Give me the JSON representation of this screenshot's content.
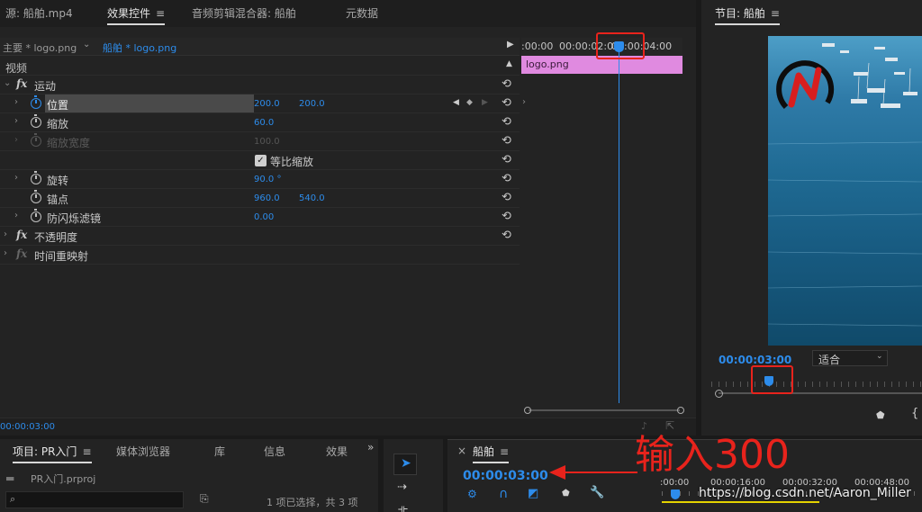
{
  "top_tabs": {
    "source": "源: 船舶.mp4",
    "effect_controls": "效果控件",
    "audio_mixer": "音频剪辑混合器: 船舶",
    "metadata": "元数据"
  },
  "program": {
    "title": "节目: 船舶",
    "timecode": "00:00:03:00",
    "fit": "适合"
  },
  "effect_panel": {
    "master_clip": "主要 * logo.png",
    "seq_clip": "船舶 * logo.png",
    "section_video": "视频",
    "timeline_times": [
      ":00:00",
      "00:00:02:00",
      "00:00:04:00"
    ],
    "clip_name": "logo.png",
    "rows": [
      {
        "label": "运动"
      },
      {
        "label": "位置",
        "v1": "200.0",
        "v2": "200.0"
      },
      {
        "label": "缩放",
        "v1": "60.0"
      },
      {
        "label": "缩放宽度",
        "v1": "100.0"
      },
      {
        "label": "等比缩放"
      },
      {
        "label": "旋转",
        "v1": "90.0 °"
      },
      {
        "label": "锚点",
        "v1": "960.0",
        "v2": "540.0"
      },
      {
        "label": "防闪烁滤镜",
        "v1": "0.00"
      },
      {
        "label": "不透明度"
      },
      {
        "label": "时间重映射"
      }
    ],
    "bottom_time": "00:00:03:00"
  },
  "project": {
    "tabs": [
      "项目: PR入门",
      "媒体浏览器",
      "库",
      "信息",
      "效果"
    ],
    "file": "PR入门.prproj",
    "search_placeholder": "",
    "selection": "1 项已选择，共 3 项"
  },
  "sequence": {
    "close": "×",
    "title": "船舶",
    "timecode": "00:00:03:00",
    "ruler": [
      ":00:00",
      "00:00:16:00",
      "00:00:32:00",
      "00:00:48:00"
    ]
  },
  "annotation": {
    "text": "输入300"
  },
  "watermark": "https://blog.csdn.net/Aaron_Miller",
  "colors": {
    "accent": "#2d8ceb",
    "clip": "#e08ae0",
    "highlight_box": "#e8231c"
  }
}
